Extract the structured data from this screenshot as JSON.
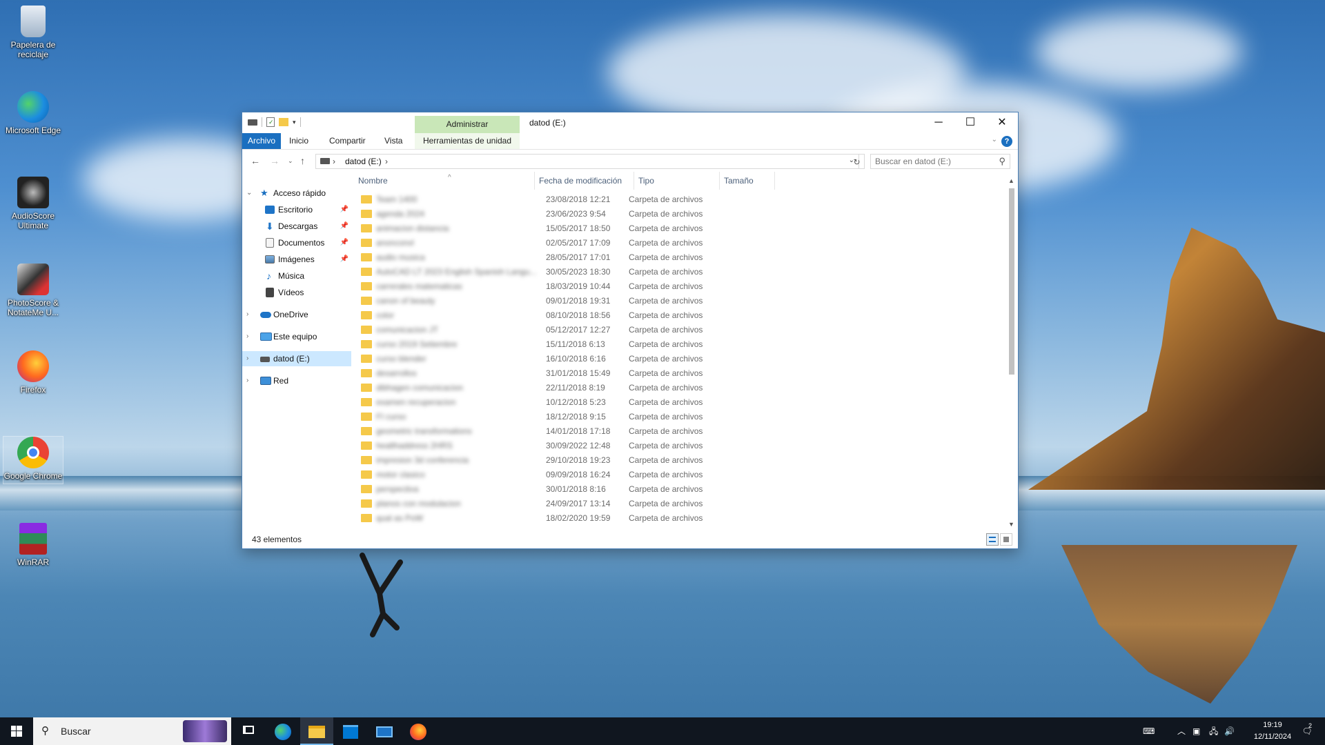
{
  "desktop": {
    "icons": [
      {
        "label": "Papelera de reciclaje",
        "icon": "recycle-bin-icon"
      },
      {
        "label": "Microsoft Edge",
        "icon": "edge-icon"
      },
      {
        "label": "AudioScore Ultimate",
        "icon": "audioscore-icon"
      },
      {
        "label": "PhotoScore & NotateMe U...",
        "icon": "photoscore-icon"
      },
      {
        "label": "Firefox",
        "icon": "firefox-icon"
      },
      {
        "label": "Google Chrome",
        "icon": "chrome-icon"
      },
      {
        "label": "WinRAR",
        "icon": "winrar-icon"
      }
    ]
  },
  "window": {
    "title": "datod (E:)",
    "manage_tab": "Administrar",
    "ribbon_tabs": [
      "Archivo",
      "Inicio",
      "Compartir",
      "Vista",
      "Herramientas de unidad"
    ],
    "address": {
      "crumb": "datod (E:)"
    },
    "search": {
      "placeholder": "Buscar en datod (E:)"
    },
    "nav": {
      "quick_access": "Acceso rápido",
      "quick_items": [
        "Escritorio",
        "Descargas",
        "Documentos",
        "Imágenes",
        "Música",
        "Vídeos"
      ],
      "onedrive": "OneDrive",
      "this_pc": "Este equipo",
      "drive": "datod (E:)",
      "network": "Red"
    },
    "columns": {
      "name": "Nombre",
      "modified": "Fecha de modificación",
      "type": "Tipo",
      "size": "Tamaño"
    },
    "files": [
      {
        "name": "Team 1400",
        "date": "23/08/2018 12:21",
        "type": "Carpeta de archivos"
      },
      {
        "name": "agenda 2024",
        "date": "23/06/2023 9:54",
        "type": "Carpeta de archivos"
      },
      {
        "name": "animacion distancia",
        "date": "15/05/2017 18:50",
        "type": "Carpeta de archivos"
      },
      {
        "name": "anonconvl",
        "date": "02/05/2017 17:09",
        "type": "Carpeta de archivos"
      },
      {
        "name": "audio musica",
        "date": "28/05/2017 17:01",
        "type": "Carpeta de archivos"
      },
      {
        "name": "AutoCAD LT 2023 English Spanish Langu...",
        "date": "30/05/2023 18:30",
        "type": "Carpeta de archivos"
      },
      {
        "name": "carrerales matematicas",
        "date": "18/03/2019 10:44",
        "type": "Carpeta de archivos"
      },
      {
        "name": "canon of beauty",
        "date": "09/01/2018 19:31",
        "type": "Carpeta de archivos"
      },
      {
        "name": "color",
        "date": "08/10/2018 18:56",
        "type": "Carpeta de archivos"
      },
      {
        "name": "comunicacion JT",
        "date": "05/12/2017 12:27",
        "type": "Carpeta de archivos"
      },
      {
        "name": "curso 2019 Setiembre",
        "date": "15/11/2018 6:13",
        "type": "Carpeta de archivos"
      },
      {
        "name": "curso blender",
        "date": "16/10/2018 6:16",
        "type": "Carpeta de archivos"
      },
      {
        "name": "desarrollos",
        "date": "31/01/2018 15:49",
        "type": "Carpeta de archivos"
      },
      {
        "name": "dibhagen comunicacion",
        "date": "22/11/2018 8:19",
        "type": "Carpeta de archivos"
      },
      {
        "name": "examen recuperacion",
        "date": "10/12/2018 5:23",
        "type": "Carpeta de archivos"
      },
      {
        "name": "FI curso",
        "date": "18/12/2018 9:15",
        "type": "Carpeta de archivos"
      },
      {
        "name": "geometric transformations",
        "date": "14/01/2018 17:18",
        "type": "Carpeta de archivos"
      },
      {
        "name": "healthaddress 2HRS",
        "date": "30/09/2022 12:48",
        "type": "Carpeta de archivos"
      },
      {
        "name": "impresion 3d conferencia",
        "date": "29/10/2018 19:23",
        "type": "Carpeta de archivos"
      },
      {
        "name": "motor clasico",
        "date": "09/09/2018 16:24",
        "type": "Carpeta de archivos"
      },
      {
        "name": "perspectiva",
        "date": "30/01/2018 8:16",
        "type": "Carpeta de archivos"
      },
      {
        "name": "planos con modulacion",
        "date": "24/09/2017 13:14",
        "type": "Carpeta de archivos"
      },
      {
        "name": "qual as PoW",
        "date": "18/02/2020 19:59",
        "type": "Carpeta de archivos"
      }
    ],
    "status": "43 elementos"
  },
  "taskbar": {
    "search_text": "Buscar",
    "time": "19:19",
    "date": "12/11/2024",
    "notification_count": "2"
  }
}
